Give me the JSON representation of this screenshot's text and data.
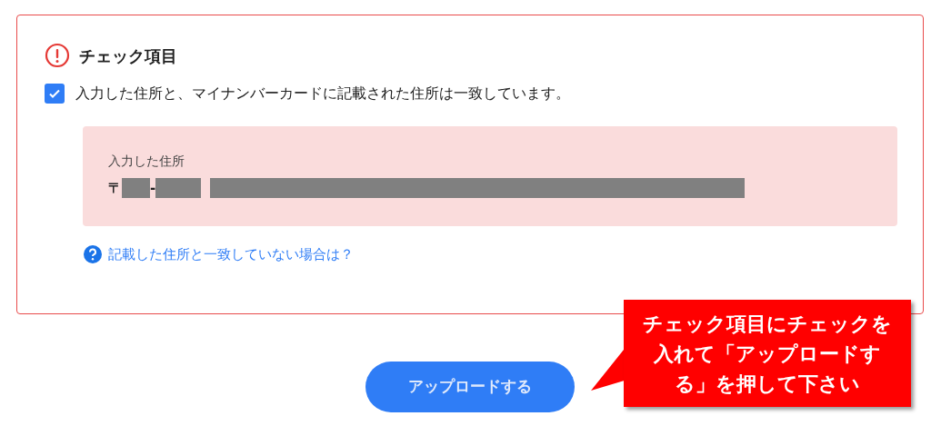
{
  "check_section": {
    "title": "チェック項目",
    "item": {
      "label": "入力した住所と、マイナンバーカードに記載された住所は一致しています。",
      "checked": true
    },
    "address_box": {
      "label": "入力した住所",
      "postal_mark": "〒",
      "separator": "-"
    },
    "help_link": "記載した住所と一致していない場合は？"
  },
  "upload_button": "アップロードする",
  "callout": {
    "lines": [
      "チェック項目にチェックを",
      "入れて「アップロードす",
      "る」を押して下さい"
    ]
  }
}
